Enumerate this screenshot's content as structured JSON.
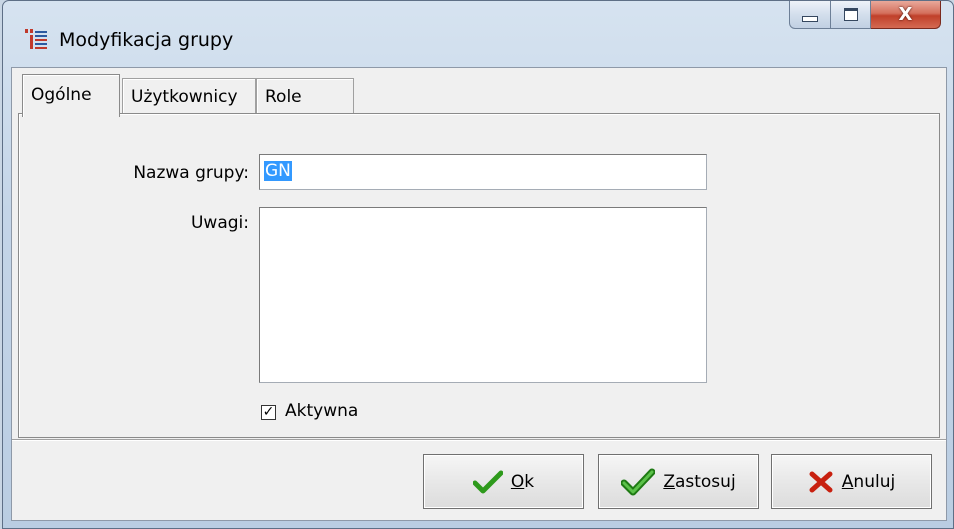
{
  "window": {
    "title": "Modyfikacja grupy"
  },
  "caption": {
    "close_glyph": "X"
  },
  "tabs": [
    {
      "label": "Ogólne",
      "active": true
    },
    {
      "label": "Użytkownicy",
      "active": false
    },
    {
      "label": "Role",
      "active": false
    }
  ],
  "form": {
    "group_name_label": "Nazwa grupy:",
    "group_name_value": "GN",
    "notes_label": "Uwagi:",
    "notes_value": "",
    "active_label": "Aktywna",
    "active_checked": true,
    "checkmark_glyph": "✓"
  },
  "buttons": {
    "ok": {
      "accel": "O",
      "rest": "k"
    },
    "apply": {
      "accel": "Z",
      "rest": "astosuj"
    },
    "cancel": {
      "accel": "A",
      "rest": "nuluj"
    }
  },
  "colors": {
    "selection": "#3399ff",
    "check_green": "#2e9a1c",
    "cancel_red": "#c8200f"
  }
}
